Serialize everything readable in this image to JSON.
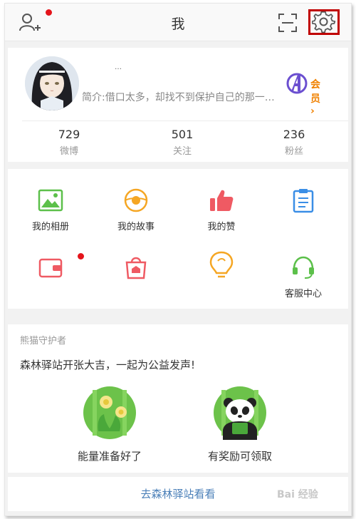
{
  "header": {
    "title": "我",
    "left_icon": "add-friend-icon",
    "right_icons": [
      "scan-icon",
      "gear-icon"
    ]
  },
  "profile": {
    "username": "…",
    "bio": "简介:借口太多，却找不到保护自己的那一…",
    "vip_label": "会员 ›",
    "stats": [
      {
        "value": "729",
        "label": "微博"
      },
      {
        "value": "501",
        "label": "关注"
      },
      {
        "value": "236",
        "label": "粉丝"
      }
    ]
  },
  "grid": {
    "items": [
      {
        "label": "我的相册",
        "icon": "photo-album-icon"
      },
      {
        "label": "我的故事",
        "icon": "story-icon"
      },
      {
        "label": "我的赞",
        "icon": "thumbs-up-icon"
      },
      {
        "label": "",
        "icon": "clipboard-icon"
      },
      {
        "label": "",
        "icon": "wallet-icon"
      },
      {
        "label": "",
        "icon": "shopping-bag-icon"
      },
      {
        "label": "",
        "icon": "lightbulb-icon"
      },
      {
        "label": "客服中心",
        "icon": "headset-icon"
      }
    ]
  },
  "panda": {
    "section_title": "熊猫守护者",
    "slogan": "森林驿站开张大吉，一起为公益发声!",
    "items": [
      {
        "label": "能量准备好了",
        "icon": "energy-flower-icon"
      },
      {
        "label": "有奖励可领取",
        "icon": "panda-reward-icon"
      }
    ],
    "link": "去森林驿站看看"
  },
  "watermark": "Bai 经验",
  "colors": {
    "accent_red": "#e4141b",
    "highlight_box": "#c00000",
    "vip_orange": "#f08100",
    "link_blue": "#4a7fb8",
    "forest_green": "#5cc04a"
  }
}
